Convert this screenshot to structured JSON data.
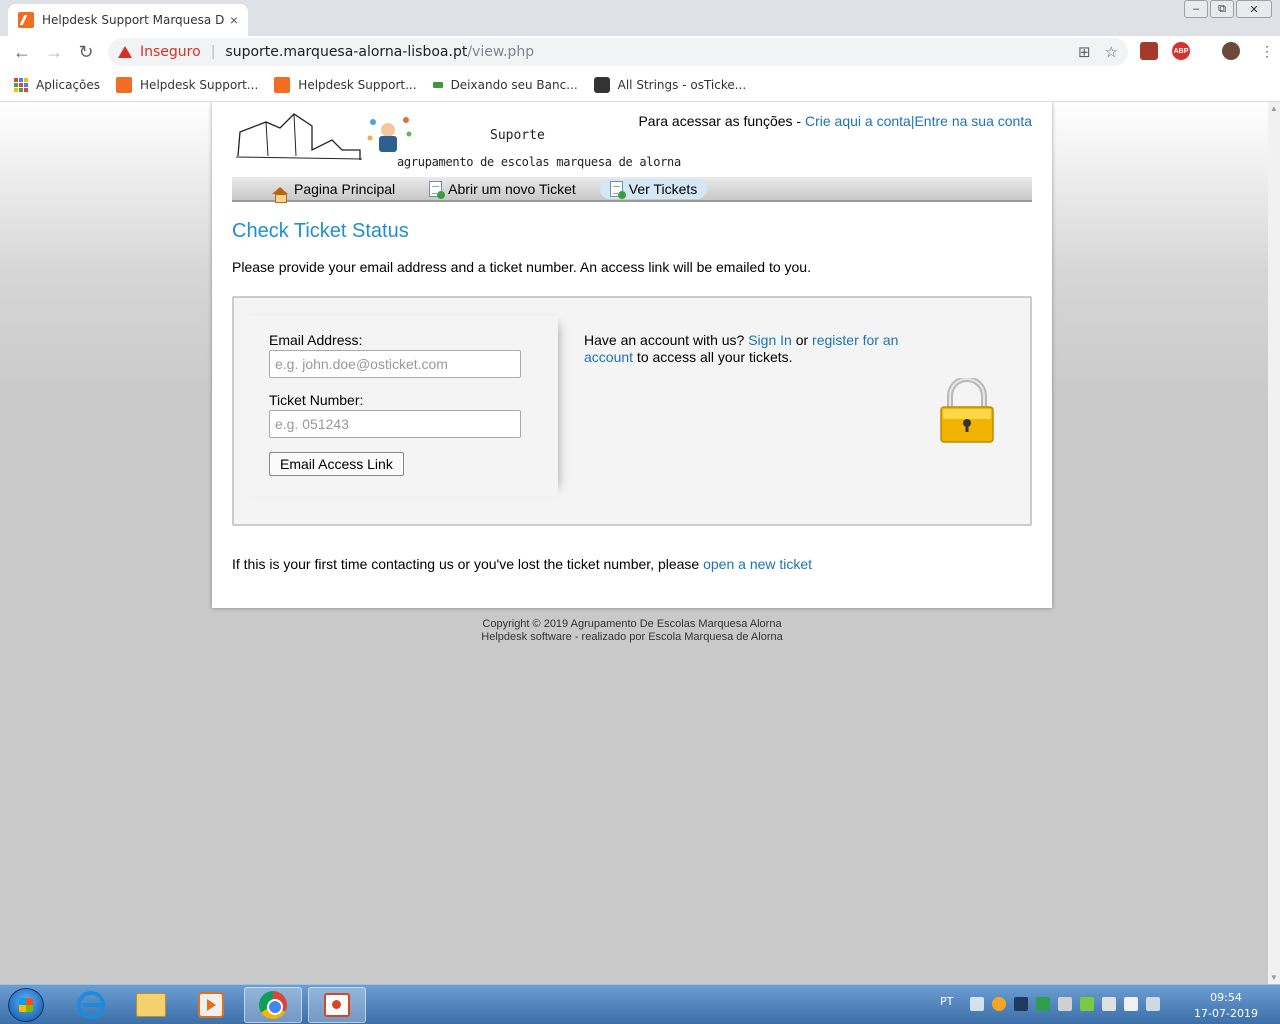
{
  "browser": {
    "tab_title": "Helpdesk Support Marquesa De",
    "tab_close": "×",
    "window_controls": [
      "‒",
      "⧉",
      "✕"
    ],
    "security_label": "Inseguro",
    "url_host": "suporte.marquesa-alorna-lisboa.pt",
    "url_path": "/view.php",
    "bookmarks": [
      {
        "label": "Aplicações",
        "icon": "apps-grid-icon"
      },
      {
        "label": "Helpdesk Support...",
        "icon": "osticket-icon"
      },
      {
        "label": "Helpdesk Support...",
        "icon": "osticket-icon"
      },
      {
        "label": "Deixando seu Banc...",
        "icon": "green-favicon-icon"
      },
      {
        "label": "All Strings - osTicke...",
        "icon": "github-icon"
      }
    ],
    "extensions": [
      {
        "name": "pdf-extension-icon",
        "color": "#a33a2b",
        "text": ""
      },
      {
        "name": "adblock-plus-icon",
        "color": "#d9312c",
        "text": "ABP"
      },
      {
        "name": "profile-avatar-icon",
        "color": "#6b4a3a",
        "text": ""
      }
    ]
  },
  "header": {
    "logo_suporte": "Suporte",
    "logo_school": "agrupamento de escolas marquesa de alorna",
    "access_prefix": "Para acessar as funções - ",
    "create_account_link": "Crie aqui a conta",
    "separator": "|",
    "sign_in_link": "Entre na sua conta"
  },
  "nav": {
    "items": [
      {
        "label": "Pagina Principal",
        "icon": "home-icon",
        "active": false
      },
      {
        "label": "Abrir um novo Ticket",
        "icon": "new-ticket-icon",
        "active": false
      },
      {
        "label": "Ver Tickets",
        "icon": "view-tickets-icon",
        "active": true
      }
    ]
  },
  "main": {
    "title": "Check Ticket Status",
    "instructions": "Please provide your email address and a ticket number. An access link will be emailed to you.",
    "form": {
      "email_label": "Email Address:",
      "email_placeholder": "e.g. john.doe@osticket.com",
      "ticket_label": "Ticket Number:",
      "ticket_placeholder": "e.g. 051243",
      "submit_label": "Email Access Link"
    },
    "account": {
      "prefix": "Have an account with us? ",
      "sign_in": "Sign In",
      "or": " or ",
      "register": "register for an account",
      "suffix": " to access all your tickets."
    },
    "footer_note": {
      "text": "If this is your first time contacting us or you've lost the ticket number, please ",
      "link": "open a new ticket"
    }
  },
  "copyright": {
    "line1": "Copyright © 2019 Agrupamento De Escolas Marquesa Alorna",
    "line2": "Helpdesk software - realizado por Escola Marquesa de Alorna"
  },
  "taskbar": {
    "apps": [
      "internet-explorer-icon",
      "file-explorer-icon",
      "media-player-icon",
      "chrome-icon",
      "powerpoint-icon"
    ],
    "active_app": "chrome-icon",
    "language": "PT",
    "time": "09:54",
    "date": "17-07-2019"
  },
  "colors": {
    "link": "#1a73b5",
    "title": "#1f8fd1",
    "insecure": "#d93025"
  }
}
